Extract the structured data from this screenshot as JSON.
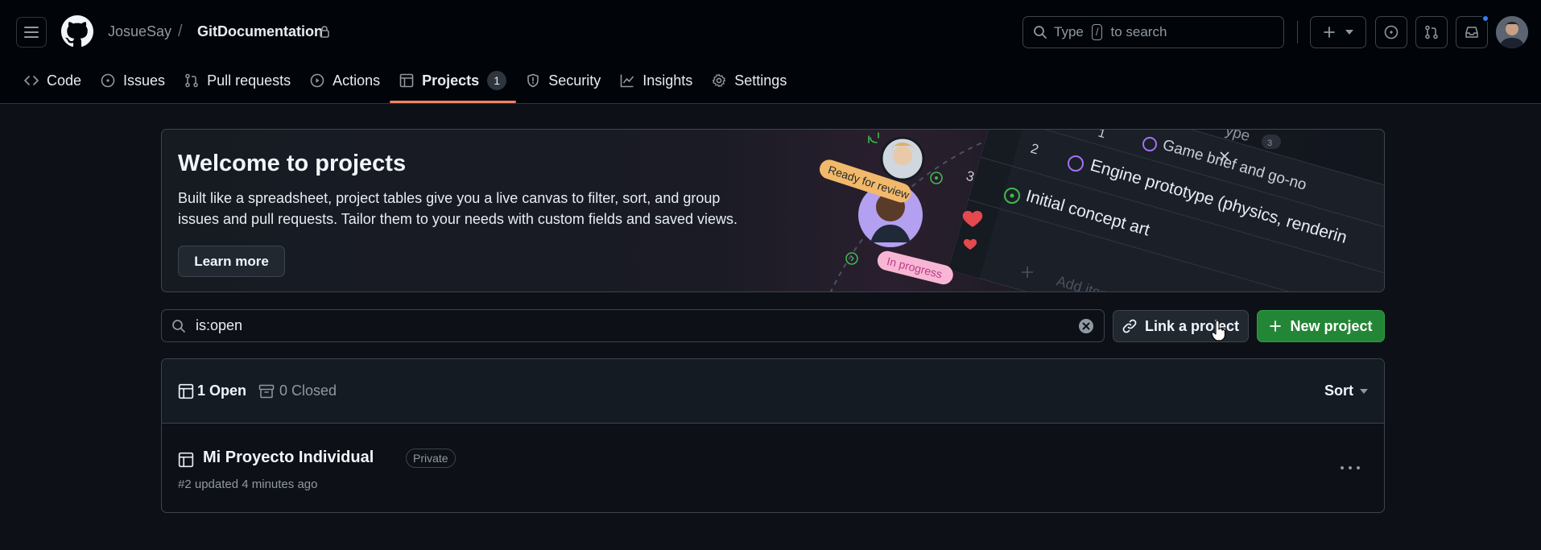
{
  "header": {
    "owner": "JosueSay",
    "separator": "/",
    "repo": "GitDocumentation",
    "search": {
      "prefix": "Type",
      "key": "/",
      "suffix": "to search"
    }
  },
  "tabs": [
    {
      "label": "Code",
      "icon": "code-icon"
    },
    {
      "label": "Issues",
      "icon": "issue-opened-icon"
    },
    {
      "label": "Pull requests",
      "icon": "git-pull-request-icon"
    },
    {
      "label": "Actions",
      "icon": "play-icon"
    },
    {
      "label": "Projects",
      "icon": "table-icon",
      "count": "1",
      "active": true
    },
    {
      "label": "Security",
      "icon": "shield-icon"
    },
    {
      "label": "Insights",
      "icon": "graph-icon"
    },
    {
      "label": "Settings",
      "icon": "gear-icon"
    }
  ],
  "banner": {
    "title": "Welcome to projects",
    "text": "Built like a spreadsheet, project tables give you a live canvas to filter, sort, and group issues and pull requests. Tailor them to your needs with custom fields and saved views.",
    "learn_more": "Learn more",
    "art": {
      "ready_label": "Ready for review",
      "progress_label": "In progress",
      "row_2_num": "2",
      "row_2_text": "Engine prototype (physics, renderin",
      "row_3_num": "3",
      "row_3_text": "Initial concept art",
      "row_1_text": "Game brief and go-no",
      "row_top_text": "ype",
      "row_top_count": "3",
      "row_1_num": "1",
      "add_item": "Add item"
    }
  },
  "filter": {
    "value": "is:open"
  },
  "buttons": {
    "link_project": "Link a project",
    "new_project": "New project"
  },
  "list": {
    "open": "1 Open",
    "closed": "0 Closed",
    "sort": "Sort",
    "projects": [
      {
        "title": "Mi Proyecto Individual",
        "badge": "Private",
        "meta": "#2 updated 4 minutes ago"
      }
    ]
  },
  "colors": {
    "accent_tab": "#f78166",
    "primary_button": "#238636",
    "notification": "#2f81f7"
  }
}
